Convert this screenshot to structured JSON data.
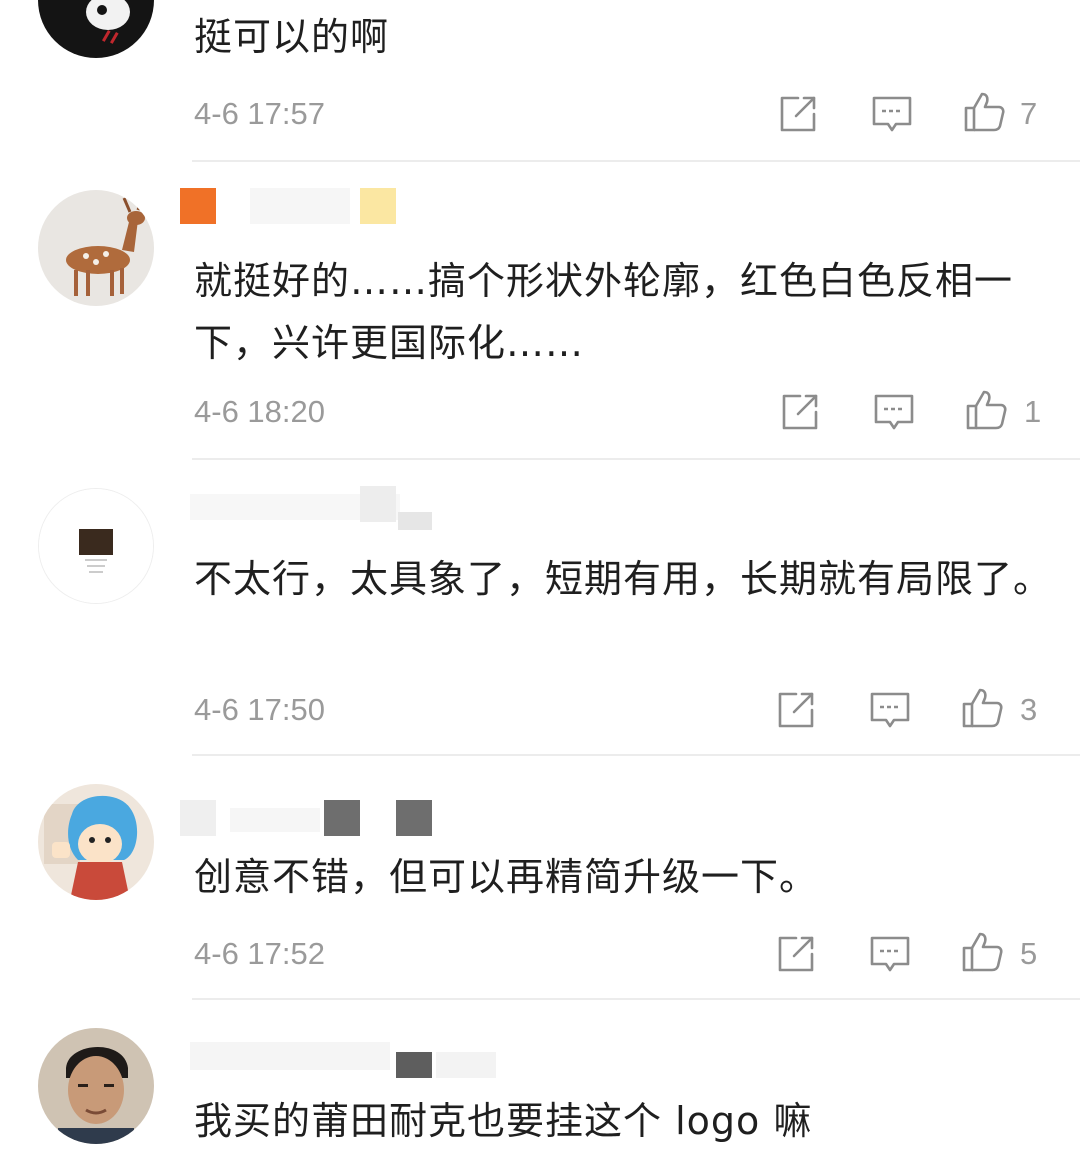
{
  "comments": [
    {
      "text": "挺可以的啊",
      "time": "4-6 17:57",
      "likes": "7"
    },
    {
      "text": "就挺好的……搞个形状外轮廓，红色白色反相一下，兴许更国际化……",
      "time": "4-6 18:20",
      "likes": "1"
    },
    {
      "text": "不太行，太具象了，短期有用，长期就有局限了。",
      "time": "4-6 17:50",
      "likes": "3"
    },
    {
      "text": "创意不错，但可以再精简升级一下。",
      "time": "4-6 17:52",
      "likes": "5"
    },
    {
      "text": "我买的莆田耐克也要挂这个 logo 嘛"
    }
  ],
  "icons": {
    "share": "share-icon",
    "reply": "comment-icon",
    "like": "thumbs-up-icon"
  },
  "colors": {
    "text": "#1f1f1f",
    "meta": "#9a9a9a",
    "divider": "#ececec",
    "icon": "#8c8c8c"
  }
}
